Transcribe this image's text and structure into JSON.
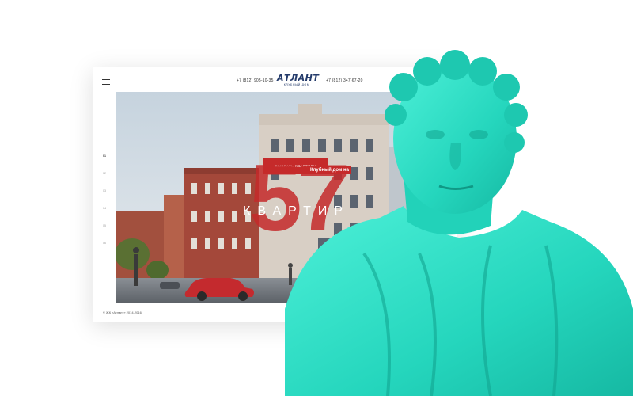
{
  "header": {
    "phone_left": "+7 (812) 905-10-35",
    "phone_right": "+7 (812) 347-67-20",
    "logo_title": "АТЛАНТ",
    "logo_subtitle": "КЛУБНЫЙ ДОМ"
  },
  "cta_label": "ВЫБРАТЬ КВАРТИРУ",
  "hero": {
    "tag": "Клубный дом на",
    "big_number": "57",
    "word": "КВАРТИР"
  },
  "pager": [
    "01",
    "02",
    "03",
    "04",
    "05",
    "06"
  ],
  "footer": "© ЖК «Атлант» 2014-2016",
  "colors": {
    "accent": "#c52a2a",
    "bust": "#2ee0c8",
    "logo": "#243b6b"
  }
}
